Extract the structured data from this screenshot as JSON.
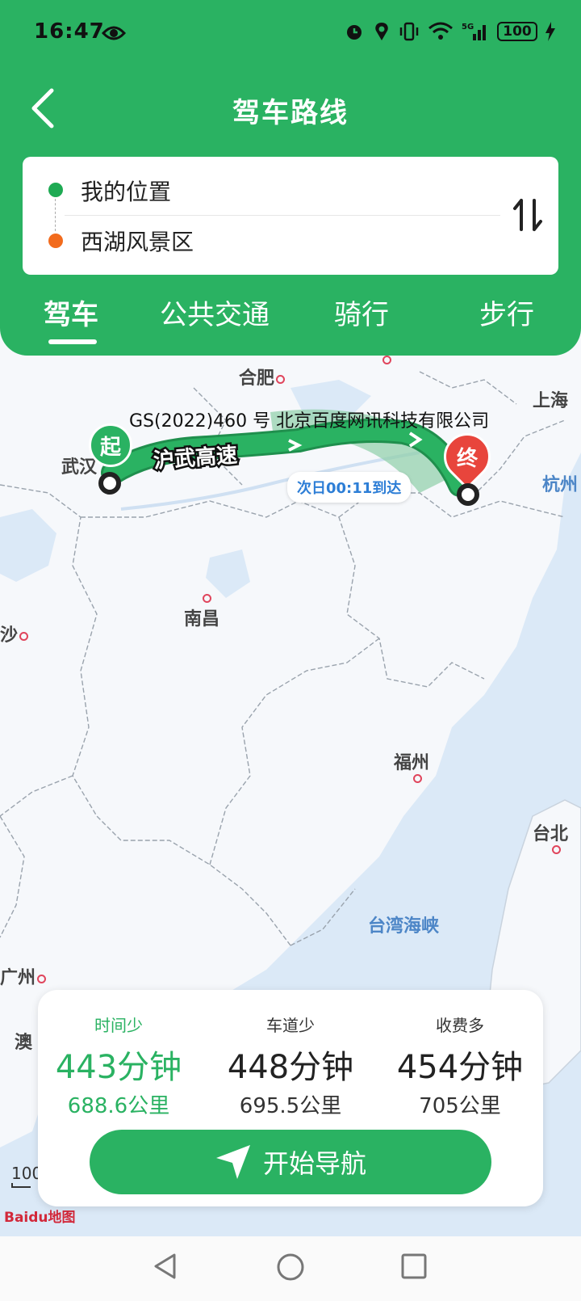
{
  "status": {
    "time": "16:47",
    "signal": "5G",
    "battery": "100"
  },
  "header": {
    "title": "驾车路线",
    "origin": "我的位置",
    "destination": "西湖风景区",
    "tabs": [
      "驾车",
      "公共交通",
      "骑行",
      "步行"
    ],
    "active_tab": "驾车"
  },
  "map": {
    "copyright": "GS(2022)460 号 北京百度网讯科技有限公司",
    "highway": "沪武高速",
    "start_marker": "起",
    "end_marker": "终",
    "arrival": "次日00:11到达",
    "cities": {
      "hefei": "合肥",
      "shanghai": "上海",
      "wuhan": "武汉",
      "hangzhou": "杭州",
      "nanchang": "南昌",
      "changsha": "沙",
      "fuzhou": "福州",
      "taipei": "台北",
      "guangzhou": "广州",
      "macau": "澳"
    },
    "strait": "台湾海峡",
    "scale": "100",
    "logo": "Baidu地图",
    "colors": {
      "route": "#2ab262",
      "route_alt": "#8fcfa8",
      "start": "#2ab262",
      "end": "#e8453c"
    }
  },
  "routes": [
    {
      "label": "时间少",
      "time": "443分钟",
      "distance": "688.6公里",
      "selected": true
    },
    {
      "label": "车道少",
      "time": "448分钟",
      "distance": "695.5公里",
      "selected": false
    },
    {
      "label": "收费多",
      "time": "454分钟",
      "distance": "705公里",
      "selected": false
    }
  ],
  "nav_button": "开始导航",
  "colors": {
    "brand_green": "#2ab262",
    "origin_dot": "#1eaa53",
    "dest_dot": "#f26b1d"
  }
}
